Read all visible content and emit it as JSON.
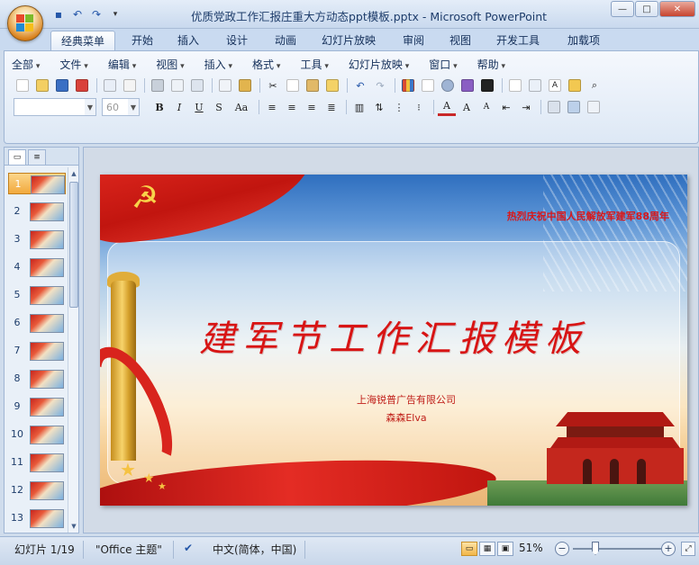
{
  "window": {
    "title": "优质党政工作汇报庄重大方动态ppt模板.pptx - Microsoft PowerPoint",
    "minimize": "—",
    "maximize": "□",
    "close": "✕"
  },
  "qat": [
    "save-icon",
    "undo-icon",
    "redo-icon",
    "customize-icon"
  ],
  "tabs": [
    "经典菜单",
    "开始",
    "插入",
    "设计",
    "动画",
    "幻灯片放映",
    "审阅",
    "视图",
    "开发工具",
    "加载项"
  ],
  "menu": [
    "全部",
    "文件",
    "编辑",
    "视图",
    "插入",
    "格式",
    "工具",
    "幻灯片放映",
    "窗口",
    "帮助"
  ],
  "font": {
    "name": "",
    "size": "60"
  },
  "slides": {
    "numbers": [
      "1",
      "2",
      "3",
      "4",
      "5",
      "6",
      "7",
      "8",
      "9",
      "10",
      "11",
      "12",
      "13"
    ],
    "selected": "1"
  },
  "slide": {
    "top_text": "热烈庆祝中国人民解放军建军88周年",
    "title": "建军节工作汇报模板",
    "company": "上海锐普广告有限公司",
    "author": "森森Elva"
  },
  "status": {
    "slide_count": "幻灯片 1/19",
    "theme": "\"Office 主题\"",
    "language": "中文(简体，中国)",
    "zoom": "51%",
    "zoom_fraction": 0.51
  },
  "colors": {
    "accent_red": "#d81414",
    "ribbon_blue": "#c9daf0"
  }
}
